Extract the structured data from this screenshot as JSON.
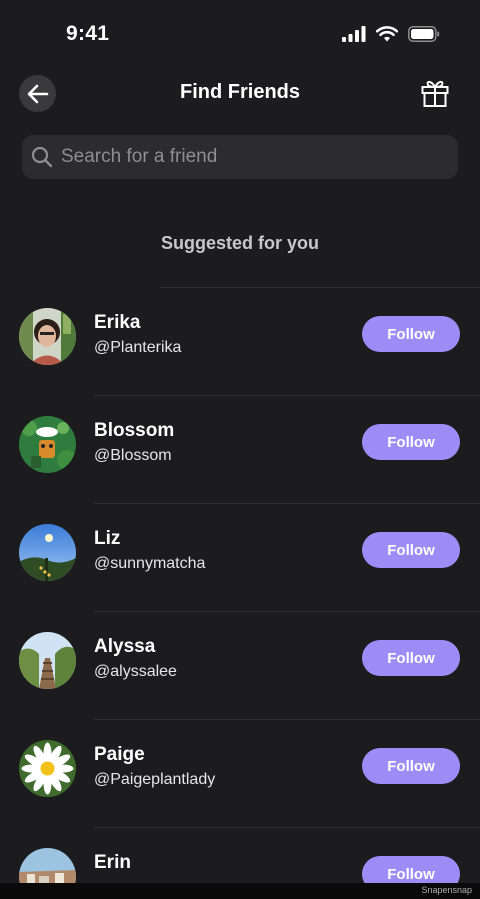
{
  "status_bar": {
    "time": "9:41"
  },
  "header": {
    "title": "Find Friends",
    "back_icon": "arrow-left-icon",
    "gift_icon": "gift-icon"
  },
  "search": {
    "placeholder": "Search for a friend",
    "value": ""
  },
  "section": {
    "heading": "Suggested for you"
  },
  "friends": [
    {
      "name": "Erika",
      "handle": "@Planterika",
      "button": "Follow"
    },
    {
      "name": "Blossom",
      "handle": "@Blossom",
      "button": "Follow"
    },
    {
      "name": "Liz",
      "handle": "@sunnymatcha",
      "button": "Follow"
    },
    {
      "name": "Alyssa",
      "handle": "@alyssalee",
      "button": "Follow"
    },
    {
      "name": "Paige",
      "handle": "@Paigeplantlady",
      "button": "Follow"
    },
    {
      "name": "Erin",
      "handle": "",
      "button": "Follow"
    }
  ],
  "footer": {
    "watermark": "Snapensnap"
  },
  "colors": {
    "background": "#1c1c1e",
    "accent": "#9d8cf5",
    "search_bg": "#2c2c2e"
  }
}
